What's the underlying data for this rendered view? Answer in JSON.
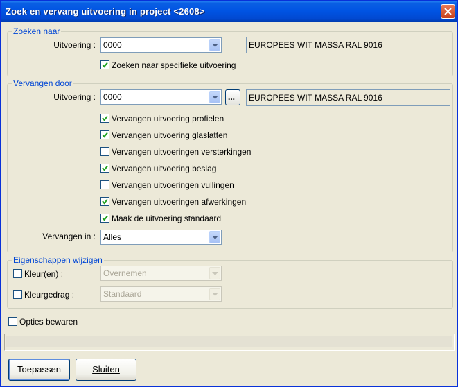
{
  "window": {
    "title": "Zoek en vervang uitvoering in project <2608>"
  },
  "zoeken": {
    "group_label": "Zoeken naar",
    "uitvoering_label": "Uitvoering :",
    "uitvoering_value": "0000",
    "description": "EUROPEES WIT MASSA RAL 9016",
    "specifiek_label": "Zoeken naar specifieke uitvoering",
    "specifiek_checked": true
  },
  "vervangen": {
    "group_label": "Vervangen door",
    "uitvoering_label": "Uitvoering :",
    "uitvoering_value": "0000",
    "browse_label": "...",
    "description": "EUROPEES WIT MASSA RAL 9016",
    "options": [
      {
        "label": "Vervangen uitvoering profielen",
        "checked": true
      },
      {
        "label": "Vervangen uitvoering glaslatten",
        "checked": true
      },
      {
        "label": "Vervangen uitvoeringen versterkingen",
        "checked": false
      },
      {
        "label": "Vervangen uitvoering beslag",
        "checked": true
      },
      {
        "label": "Vervangen uitvoeringen vullingen",
        "checked": false
      },
      {
        "label": "Vervangen uitvoeringen afwerkingen",
        "checked": true
      },
      {
        "label": "Maak de uitvoering standaard",
        "checked": true
      }
    ],
    "vervangen_in_label": "Vervangen in :",
    "vervangen_in_value": "Alles"
  },
  "eigenschappen": {
    "group_label": "Eigenschappen wijzigen",
    "kleuren_label": "Kleur(en) :",
    "kleuren_checked": false,
    "kleuren_value": "Overnemen",
    "kleurgedrag_label": "Kleurgedrag :",
    "kleurgedrag_checked": false,
    "kleurgedrag_value": "Standaard"
  },
  "opties_bewaren": {
    "label": "Opties bewaren",
    "checked": false
  },
  "buttons": {
    "apply": "Toepassen",
    "close": "Sluiten"
  },
  "colors": {
    "titlebar": "#0054e3",
    "group_label": "#0046d5",
    "dialog_bg": "#ece9d8",
    "checkmark": "#21a121"
  }
}
